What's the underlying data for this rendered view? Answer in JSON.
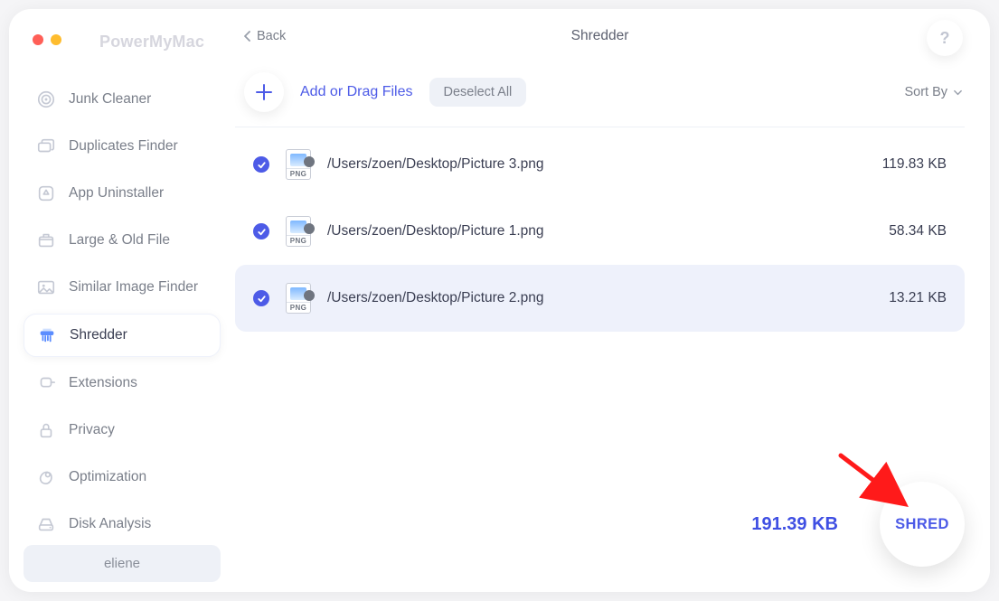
{
  "brand": "PowerMyMac",
  "header": {
    "back_label": "Back",
    "title": "Shredder",
    "help_symbol": "?"
  },
  "toolbar": {
    "add_label": "Add or Drag Files",
    "deselect_label": "Deselect All",
    "sort_label": "Sort By"
  },
  "sidebar": {
    "items": [
      {
        "label": "Junk Cleaner",
        "icon": "target"
      },
      {
        "label": "Duplicates Finder",
        "icon": "folders"
      },
      {
        "label": "App Uninstaller",
        "icon": "app"
      },
      {
        "label": "Large & Old File",
        "icon": "box"
      },
      {
        "label": "Similar Image Finder",
        "icon": "image"
      },
      {
        "label": "Shredder",
        "icon": "shredder",
        "active": true
      },
      {
        "label": "Extensions",
        "icon": "plug"
      },
      {
        "label": "Privacy",
        "icon": "lock"
      },
      {
        "label": "Optimization",
        "icon": "bean"
      },
      {
        "label": "Disk Analysis",
        "icon": "disk"
      }
    ]
  },
  "files": [
    {
      "path": "/Users/zoen/Desktop/Picture 3.png",
      "size": "119.83 KB",
      "ext": "PNG",
      "checked": true
    },
    {
      "path": "/Users/zoen/Desktop/Picture 1.png",
      "size": "58.34 KB",
      "ext": "PNG",
      "checked": true
    },
    {
      "path": "/Users/zoen/Desktop/Picture 2.png",
      "size": "13.21 KB",
      "ext": "PNG",
      "checked": true,
      "highlighted": true
    }
  ],
  "footer": {
    "total": "191.39 KB",
    "action_label": "SHRED"
  },
  "user": "eliene",
  "colors": {
    "accent": "#4d5be7"
  }
}
